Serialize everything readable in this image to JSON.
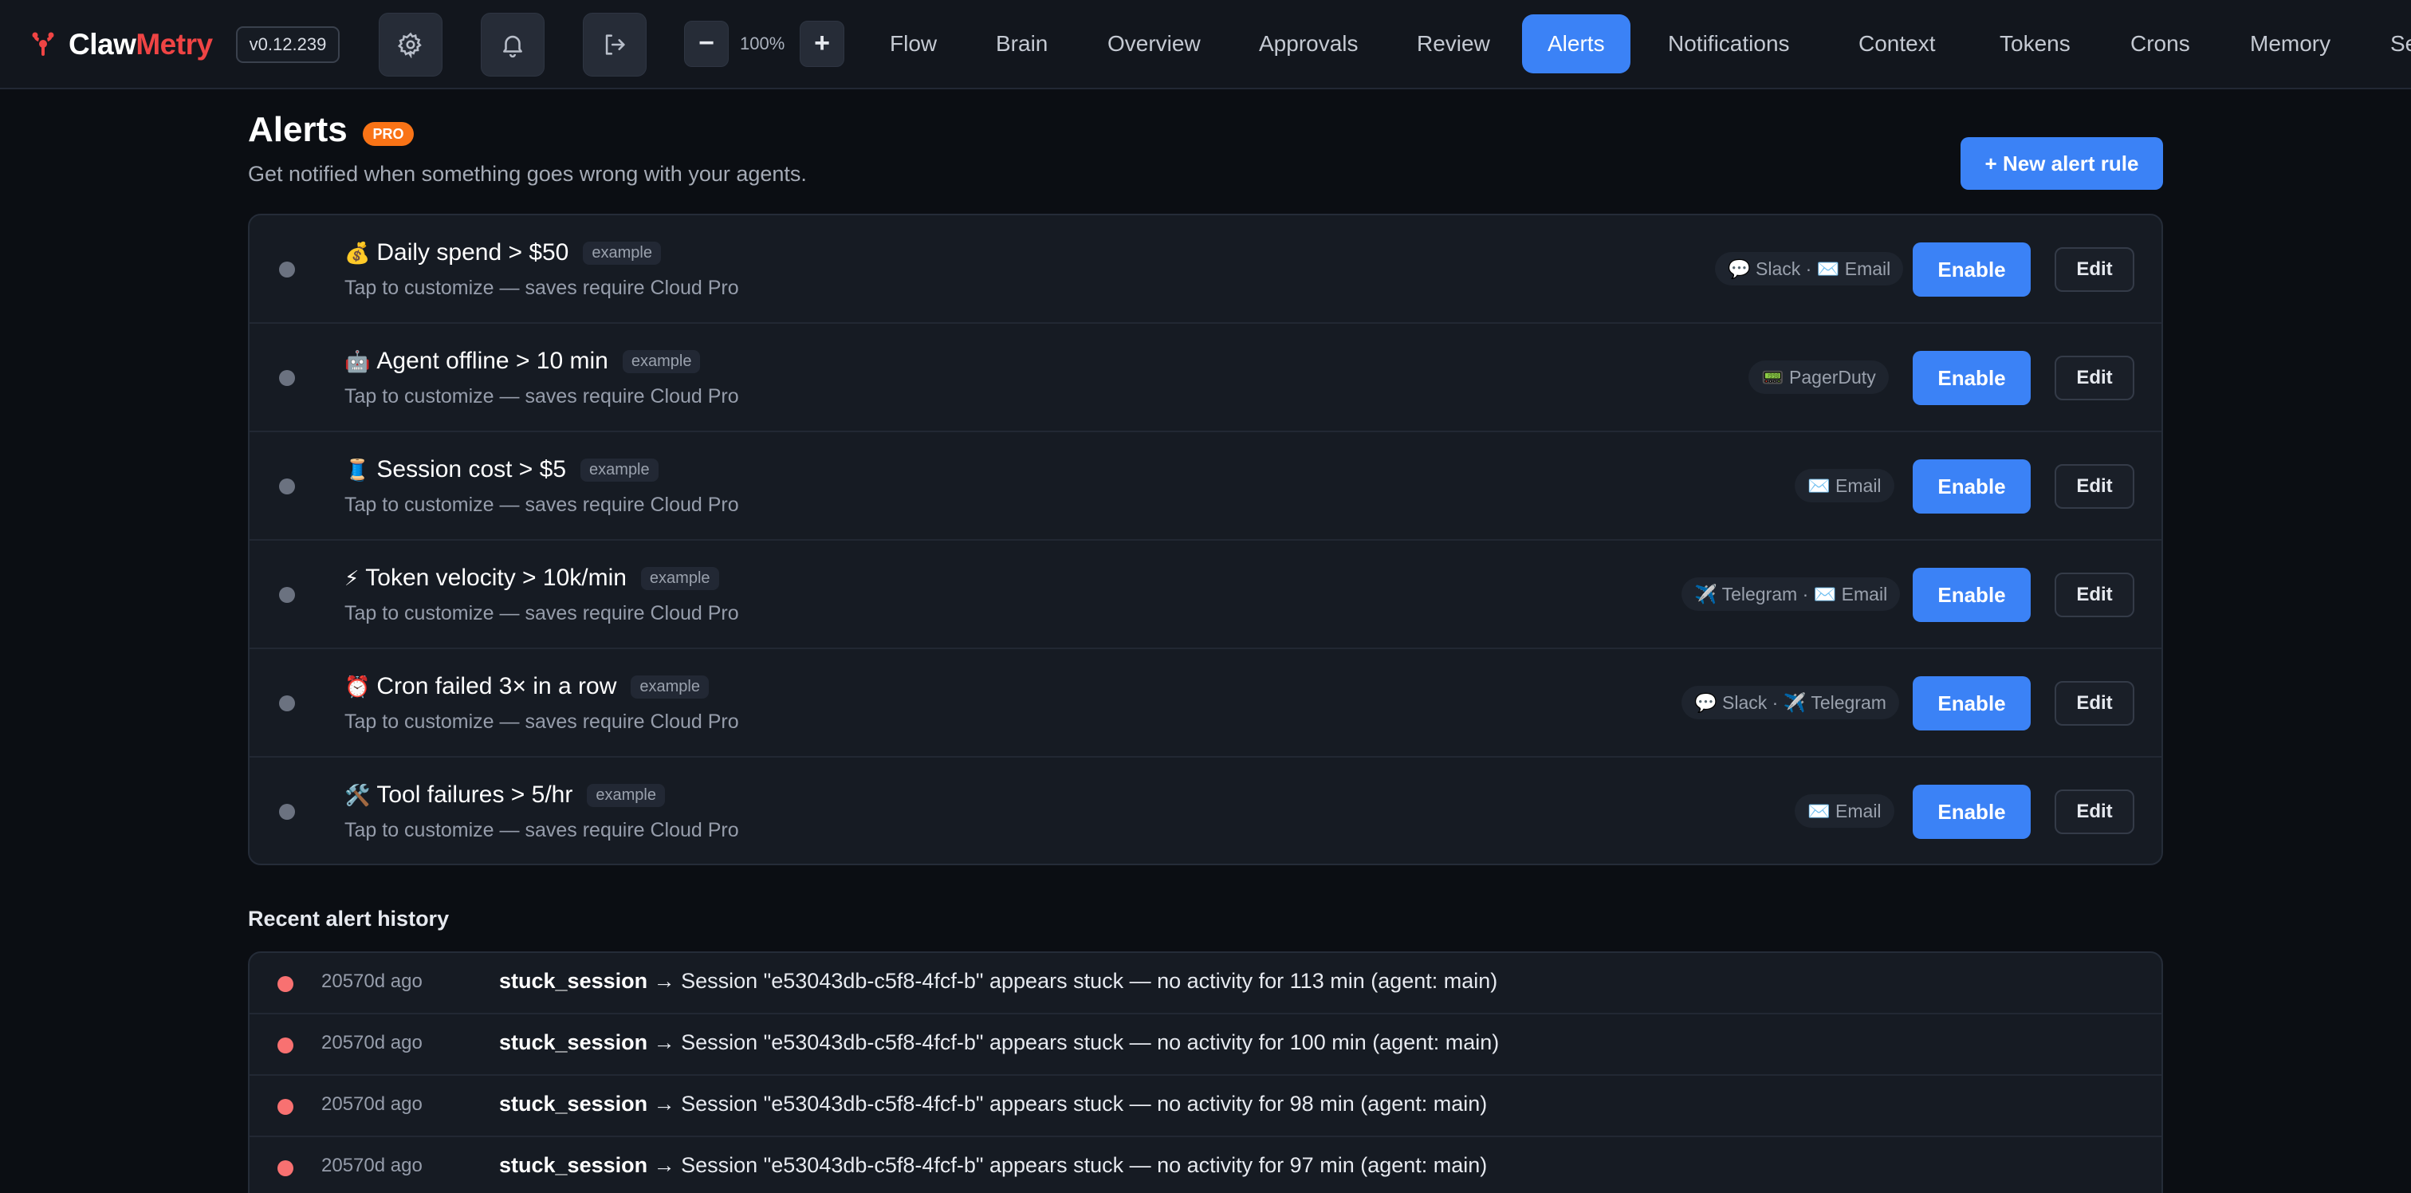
{
  "app": {
    "name_part1": "Claw",
    "name_part2": "Metry",
    "version": "v0.12.239",
    "zoom": "100%",
    "zoom_out": "−",
    "zoom_in": "+"
  },
  "nav": {
    "tabs": [
      {
        "label": "Flow"
      },
      {
        "label": "Brain"
      },
      {
        "label": "Overview"
      },
      {
        "label": "Approvals"
      },
      {
        "label": "Review"
      },
      {
        "label": "Alerts",
        "active": true
      },
      {
        "label": "Notifications"
      },
      {
        "label": "Context"
      },
      {
        "label": "Tokens"
      },
      {
        "label": "Crons"
      },
      {
        "label": "Memory"
      },
      {
        "label": "Se"
      }
    ]
  },
  "page": {
    "title": "Alerts",
    "badge": "PRO",
    "subtitle": "Get notified when something goes wrong with your agents.",
    "new_rule_label": "+ New alert rule"
  },
  "rules": [
    {
      "emoji": "💰",
      "title": "Daily spend > $50",
      "tag": "example",
      "subtitle": "Tap to customize — saves require Cloud Pro",
      "channels": "💬 Slack · ✉️ Email",
      "enable_label": "Enable",
      "edit_label": "Edit"
    },
    {
      "emoji": "🤖",
      "title": "Agent offline > 10 min",
      "tag": "example",
      "subtitle": "Tap to customize — saves require Cloud Pro",
      "channels": "📟 PagerDuty",
      "enable_label": "Enable",
      "edit_label": "Edit"
    },
    {
      "emoji": "🧵",
      "title": "Session cost > $5",
      "tag": "example",
      "subtitle": "Tap to customize — saves require Cloud Pro",
      "channels": "✉️ Email",
      "enable_label": "Enable",
      "edit_label": "Edit"
    },
    {
      "emoji": "⚡",
      "title": "Token velocity > 10k/min",
      "tag": "example",
      "subtitle": "Tap to customize — saves require Cloud Pro",
      "channels": "✈️ Telegram · ✉️ Email",
      "enable_label": "Enable",
      "edit_label": "Edit"
    },
    {
      "emoji": "⏰",
      "title": "Cron failed 3× in a row",
      "tag": "example",
      "subtitle": "Tap to customize — saves require Cloud Pro",
      "channels": "💬 Slack · ✈️ Telegram",
      "enable_label": "Enable",
      "edit_label": "Edit"
    },
    {
      "emoji": "🛠️",
      "title": "Tool failures > 5/hr",
      "tag": "example",
      "subtitle": "Tap to customize — saves require Cloud Pro",
      "channels": "✉️ Email",
      "enable_label": "Enable",
      "edit_label": "Edit"
    }
  ],
  "history": {
    "title": "Recent alert history",
    "items": [
      {
        "time": "20570d ago",
        "type": "stuck_session",
        "message": " → Session \"e53043db-c5f8-4fcf-b\" appears stuck — no activity for 113 min (agent: main)"
      },
      {
        "time": "20570d ago",
        "type": "stuck_session",
        "message": " → Session \"e53043db-c5f8-4fcf-b\" appears stuck — no activity for 100 min (agent: main)"
      },
      {
        "time": "20570d ago",
        "type": "stuck_session",
        "message": " → Session \"e53043db-c5f8-4fcf-b\" appears stuck — no activity for 98 min (agent: main)"
      },
      {
        "time": "20570d ago",
        "type": "stuck_session",
        "message": " → Session \"e53043db-c5f8-4fcf-b\" appears stuck — no activity for 97 min (agent: main)"
      }
    ]
  },
  "colors": {
    "accent": "#3b82f6",
    "brand_red": "#ef4444",
    "pro_orange": "#f97316",
    "alert_red": "#f87171",
    "background": "#0b0e13"
  }
}
